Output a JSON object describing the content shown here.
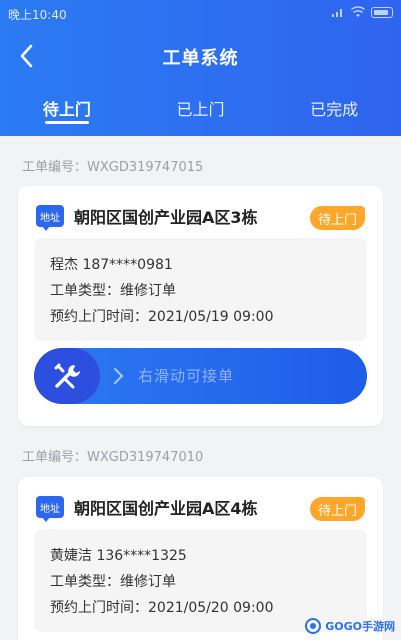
{
  "status_bar": {
    "time": "晚上10:40"
  },
  "header": {
    "title": "工单系统",
    "tabs": [
      {
        "label": "待上门",
        "active": true
      },
      {
        "label": "已上门",
        "active": false
      },
      {
        "label": "已完成",
        "active": false
      }
    ]
  },
  "orders": [
    {
      "order_no": "工单编号：WXGD319747015",
      "addr_badge": "地址",
      "address": "朝阳区国创产业园A区3栋",
      "status": "待上门",
      "contact": "程杰 187****0981",
      "type": "工单类型：维修订单",
      "time": "预约上门时间：2021/05/19 09:00",
      "slider_text": "右滑动可接单"
    },
    {
      "order_no": "工单编号：WXGD319747010",
      "addr_badge": "地址",
      "address": "朝阳区国创产业园A区4栋",
      "status": "待上门",
      "contact": "黄婕洁 136****1325",
      "type": "工单类型：维修订单",
      "time": "预约上门时间：2021/05/20 09:00"
    }
  ],
  "watermark": {
    "brand": "GOGO手游网"
  },
  "colors": {
    "primary": "#2d67f0",
    "badge": "#ffa72a"
  }
}
